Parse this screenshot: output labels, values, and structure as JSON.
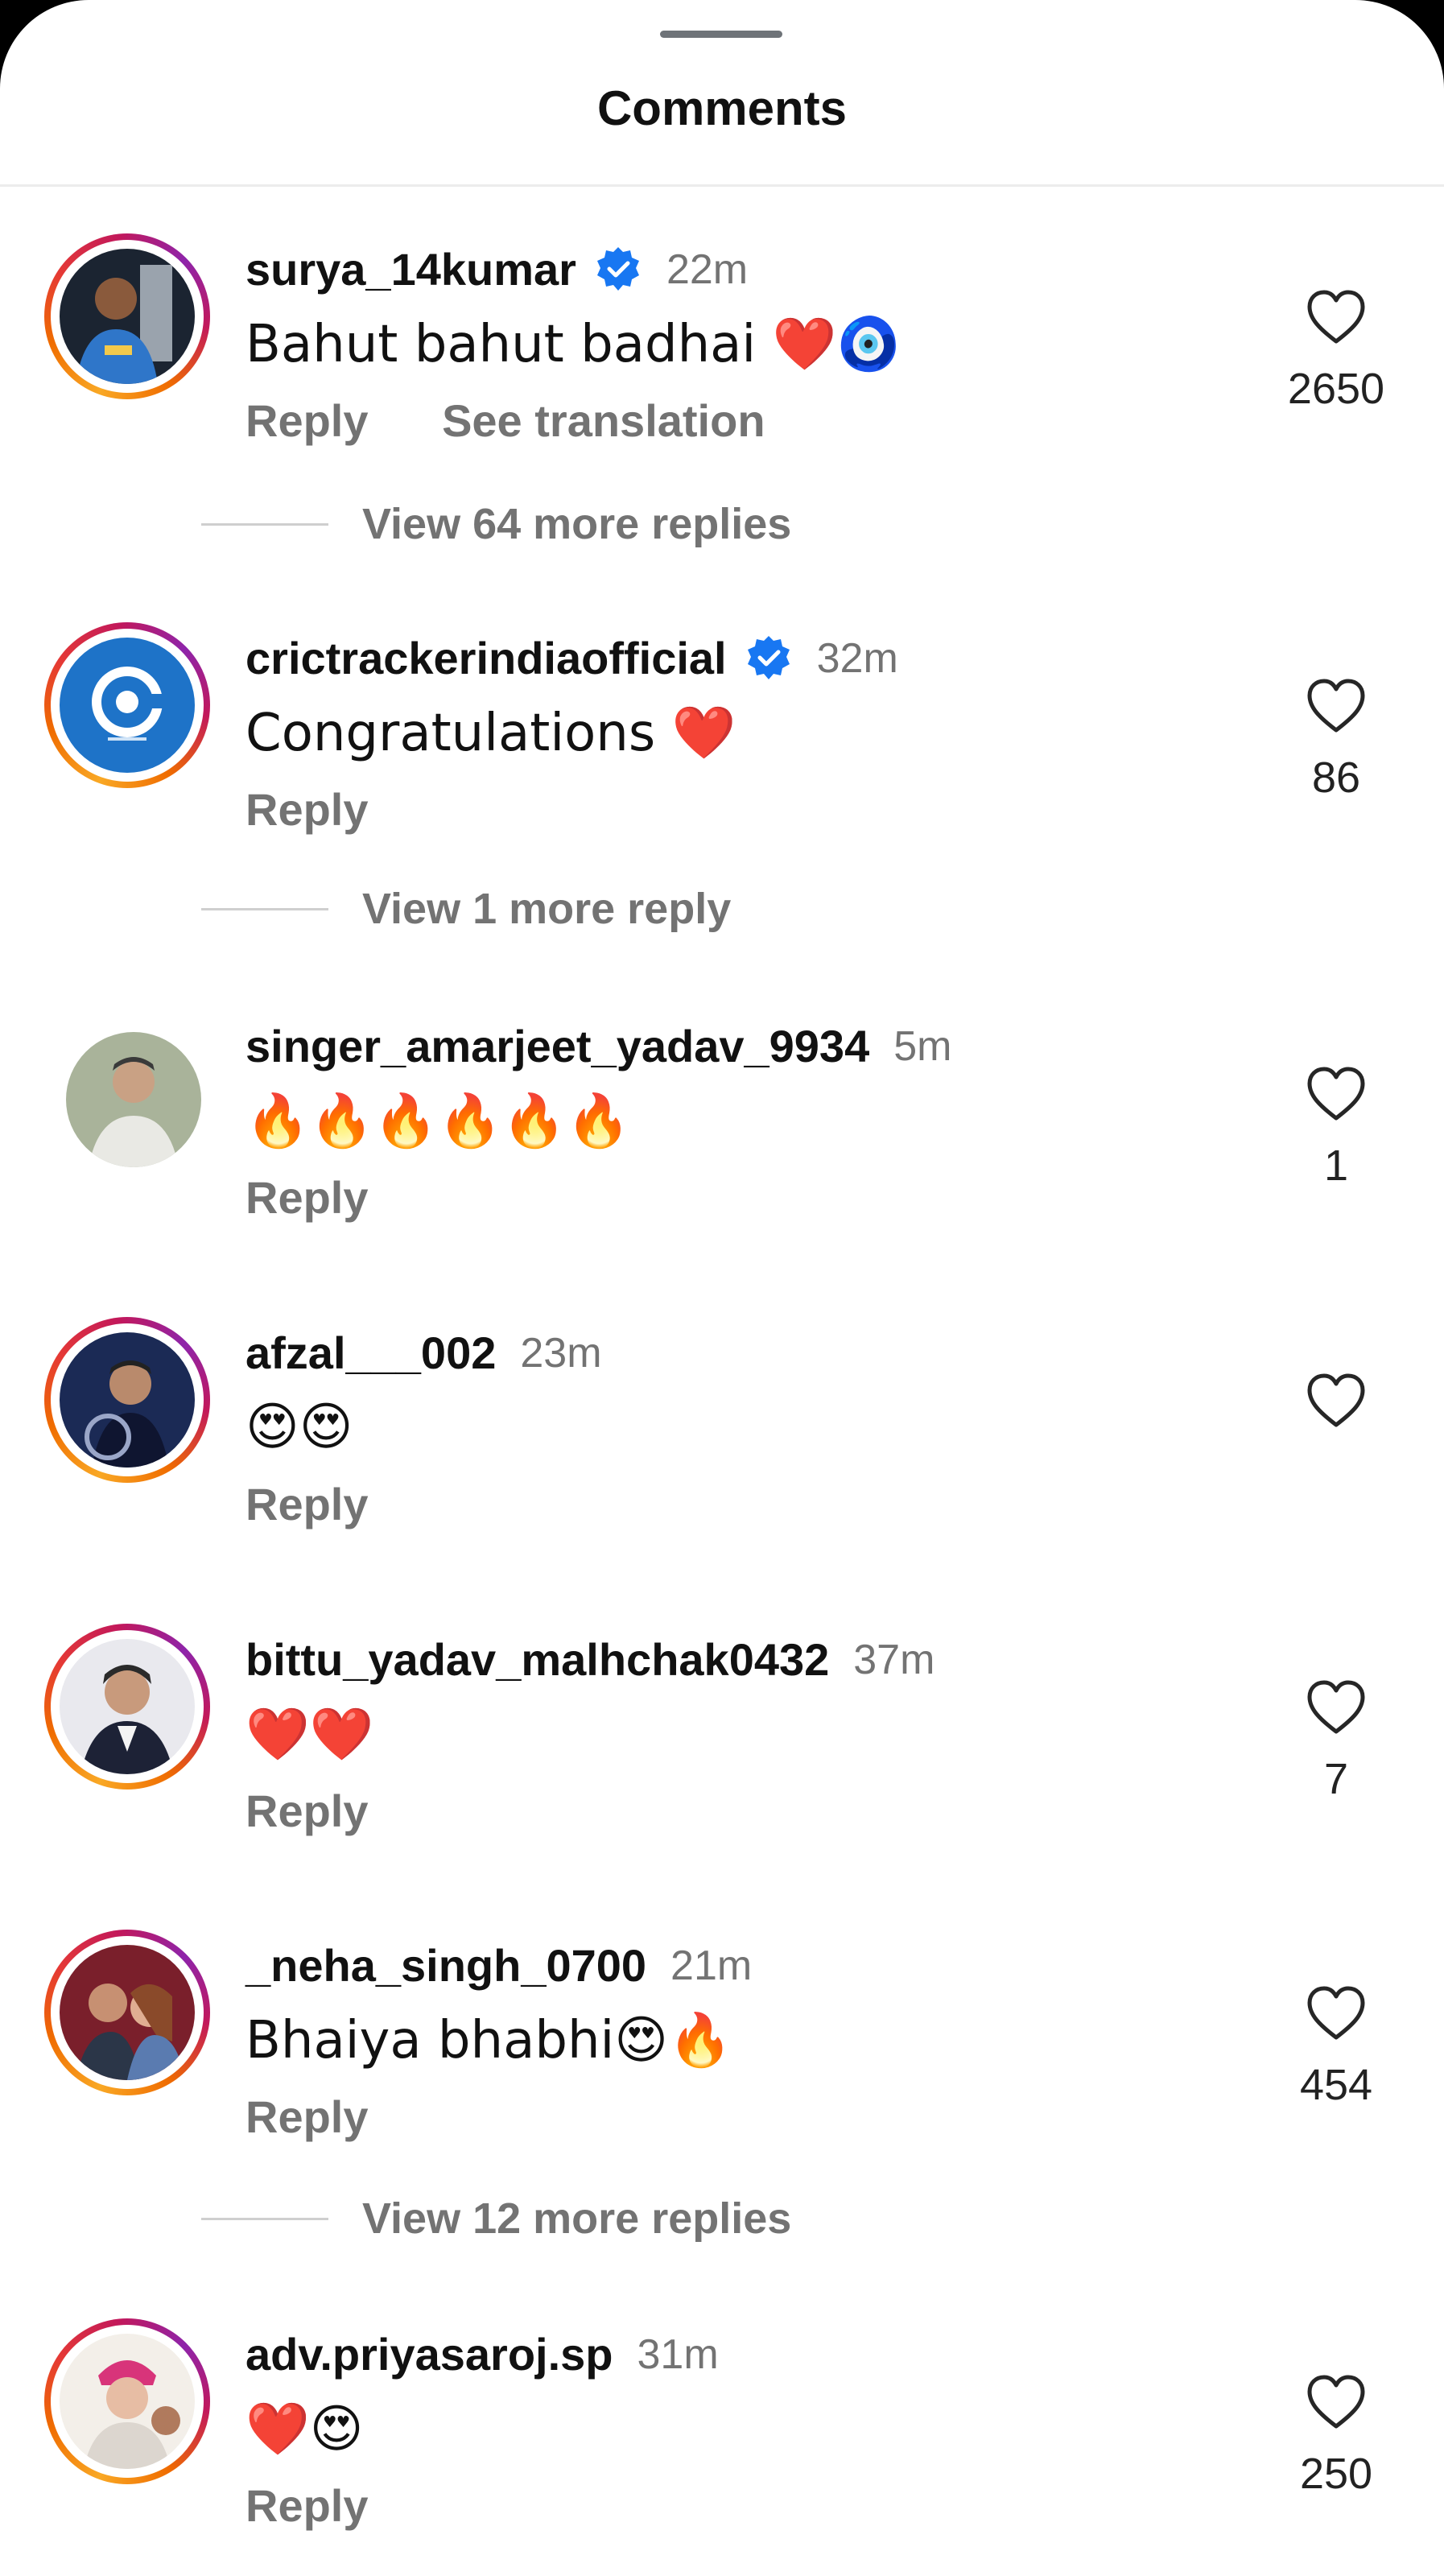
{
  "header": {
    "title": "Comments"
  },
  "comments": [
    {
      "username": "surya_14kumar",
      "verified": true,
      "time": "22m",
      "text": "Bahut bahut badhai ❤️🧿",
      "reply": "Reply",
      "see_translation": "See translation",
      "likes": "2650",
      "view_more": "View 64 more replies",
      "ring": true
    },
    {
      "username": "crictrackerindiaofficial",
      "verified": true,
      "time": "32m",
      "text": "Congratulations ❤️",
      "reply": "Reply",
      "likes": "86",
      "view_more": "View 1 more reply",
      "ring": true
    },
    {
      "username": "singer_amarjeet_yadav_9934",
      "verified": false,
      "time": "5m",
      "text": "🔥🔥🔥🔥🔥🔥",
      "reply": "Reply",
      "likes": "1",
      "ring": false
    },
    {
      "username": "afzal___002",
      "verified": false,
      "time": "23m",
      "text": "😍😍",
      "reply": "Reply",
      "likes": "",
      "ring": true
    },
    {
      "username": "bittu_yadav_malhchak0432",
      "verified": false,
      "time": "37m",
      "text": "❤️❤️",
      "reply": "Reply",
      "likes": "7",
      "ring": true
    },
    {
      "username": "_neha_singh_0700",
      "verified": false,
      "time": "21m",
      "text": "Bhaiya bhabhi😍🔥",
      "reply": "Reply",
      "likes": "454",
      "view_more": "View 12 more replies",
      "ring": true
    },
    {
      "username": "adv.priyasaroj.sp",
      "verified": false,
      "time": "31m",
      "text": "❤️😍",
      "reply": "Reply",
      "likes": "250",
      "ring": true
    }
  ]
}
